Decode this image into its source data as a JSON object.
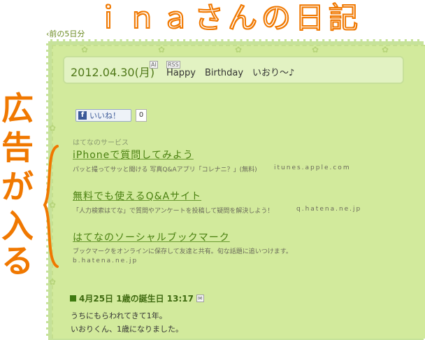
{
  "blog": {
    "title": "ｉｎａさんの日記",
    "prev_link": "‹前の5日分"
  },
  "entry": {
    "date": "2012.04.30(月)",
    "badge_a": "AI",
    "badge_rss": "RSS",
    "title": "Happy　Birthday　いおり～♪"
  },
  "like_button": {
    "label": "いいね！",
    "fb_letter": "f",
    "count": "0"
  },
  "ads": {
    "header": "はてなのサービス",
    "items": [
      {
        "title": "iPhoneで質問してみよう",
        "desc": "パッと撮ってサッと聞ける 写真Q&Aアプリ「コレナニ？」(無料)",
        "url": "itunes.apple.com"
      },
      {
        "title": "無料でも使えるQ&Aサイト",
        "desc": "「人力検索はてな」で質問やアンケートを投稿して疑問を解決しよう！",
        "url": "q.hatena.ne.jp"
      },
      {
        "title": "はてなのソーシャルブックマーク",
        "desc": "ブックマークをオンラインに保存して友達と共有。旬な話題に追いつけます。",
        "url": "b.hatena.ne.jp"
      }
    ]
  },
  "annotation": {
    "chars": [
      "広",
      "告",
      "が",
      "入",
      "る"
    ],
    "color": "#f07800"
  },
  "entry2": {
    "title": "4月25日  1歳の誕生日  13:17",
    "badge": "✉",
    "lines": [
      "うちにもらわれてきて1年。",
      "いおりくん、1歳になりました。"
    ]
  },
  "colors": {
    "frame_green": "#c6e29a",
    "link_green": "#4a8010",
    "accent_orange": "#f07800"
  }
}
